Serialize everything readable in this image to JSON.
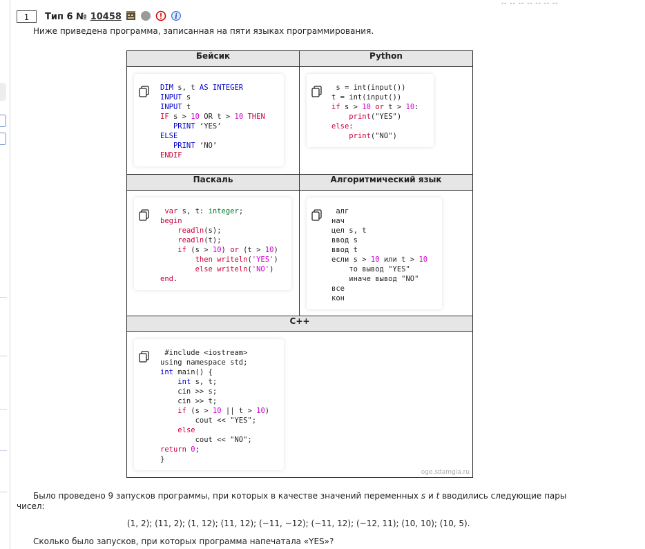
{
  "header": {
    "number": "1",
    "type_label": "Тип 6 №",
    "task_id": "10458"
  },
  "intro": "Ниже приведена программа, записанная на пяти языках программирования.",
  "languages": {
    "basic": "Бейсик",
    "python": "Python",
    "pascal": "Паскаль",
    "algo": "Алгоритмический язык",
    "cpp": "C++"
  },
  "watermark": "oge.sdamgia.ru",
  "question": {
    "line1": "Было проведено 9 запусков программы, при которых в качестве значений переменных s и t вводились следующие пары",
    "line1_a": "Было проведено 9 запусков программы, при которых в качестве значений переменных ",
    "var_s": "s",
    "line1_b": " и ",
    "var_t": "t",
    "line1_c": " вводились следующие пары",
    "line2": "чисел:",
    "pairs": "(1, 2); (11, 2); (1, 12); (11, 12); (−11, −12); (−11, 12); (−12, 11); (10, 10); (10, 5).",
    "ask": "Сколько было запусков, при которых программа напечатала «YES»?"
  },
  "icons": {
    "copy": "copy-icon",
    "film": "film-icon",
    "circle": "grey-circle-icon",
    "alert": "alert-icon",
    "info": "info-icon"
  },
  "colors": {
    "keyword_blue": "#0000c8",
    "keyword_red": "#c8003a",
    "keyword_green": "#00782a",
    "number_magenta": "#d000d0"
  }
}
